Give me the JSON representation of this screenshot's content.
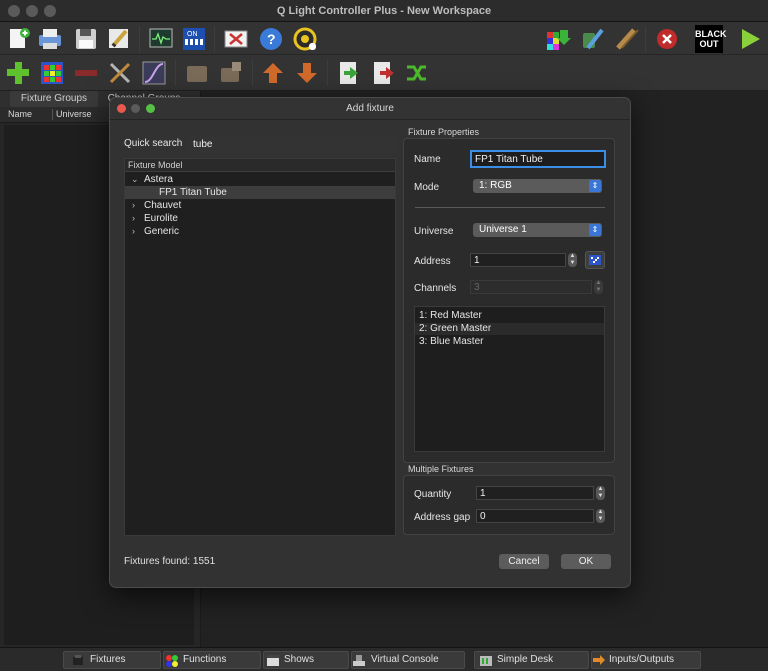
{
  "app": {
    "title": "Q Light Controller Plus - New Workspace"
  },
  "toolbar_main": {
    "icons": [
      "new-workspace-icon",
      "open-workspace-icon",
      "save-workspace-icon",
      "edit-mode-icon",
      "monitor-icon",
      "address-tool-icon",
      "close-icon",
      "help-icon",
      "about-icon",
      "dump-dmx-icon",
      "live-edit-icon",
      "fader-edit-icon",
      "stop-all-icon",
      "blackout-icon",
      "play-icon"
    ],
    "blackout_label": "BLACK OUT"
  },
  "toolbar_fixtures": {
    "icons": [
      "add-fixture-icon",
      "add-rgb-panel-icon",
      "remove-fixture-icon",
      "configure-fixture-icon",
      "fade-config-icon",
      "group-fixture-icon",
      "new-group-icon",
      "move-up-icon",
      "move-down-icon",
      "import-fixtures-icon",
      "export-fixtures-icon",
      "remap-fixtures-icon"
    ]
  },
  "left_panel": {
    "tabs": [
      "Fixture Groups",
      "Channel Groups"
    ],
    "columns": [
      "Name",
      "Universe"
    ]
  },
  "bottom_tabs": [
    {
      "label": "Fixtures",
      "icon": "fixtures-icon"
    },
    {
      "label": "Functions",
      "icon": "functions-icon"
    },
    {
      "label": "Shows",
      "icon": "shows-icon"
    },
    {
      "label": "Virtual Console",
      "icon": "virtual-console-icon"
    },
    {
      "label": "Simple Desk",
      "icon": "simple-desk-icon"
    },
    {
      "label": "Inputs/Outputs",
      "icon": "inputs-outputs-icon"
    }
  ],
  "dialog": {
    "title": "Add fixture",
    "quick_search_label": "Quick search",
    "quick_search_value": "tube",
    "tree_header": "Fixture Model",
    "tree": [
      {
        "label": "Astera",
        "expanded": true,
        "children": [
          "FP1 Titan Tube"
        ]
      },
      {
        "label": "Chauvet",
        "expanded": false
      },
      {
        "label": "Eurolite",
        "expanded": false
      },
      {
        "label": "Generic",
        "expanded": false
      }
    ],
    "selected_model": "FP1 Titan Tube",
    "fixtures_found": "Fixtures found: 1551",
    "properties": {
      "group_label": "Fixture Properties",
      "name_label": "Name",
      "name_value": "FP1 Titan Tube",
      "mode_label": "Mode",
      "mode_value": "1: RGB",
      "universe_label": "Universe",
      "universe_value": "Universe 1",
      "address_label": "Address",
      "address_value": "1",
      "channels_label": "Channels",
      "channels_value": "3",
      "channel_list": [
        "1: Red Master",
        "2: Green Master",
        "3: Blue Master"
      ]
    },
    "multiple": {
      "group_label": "Multiple Fixtures",
      "quantity_label": "Quantity",
      "quantity_value": "1",
      "gap_label": "Address gap",
      "gap_value": "0"
    },
    "buttons": {
      "cancel": "Cancel",
      "ok": "OK"
    }
  }
}
